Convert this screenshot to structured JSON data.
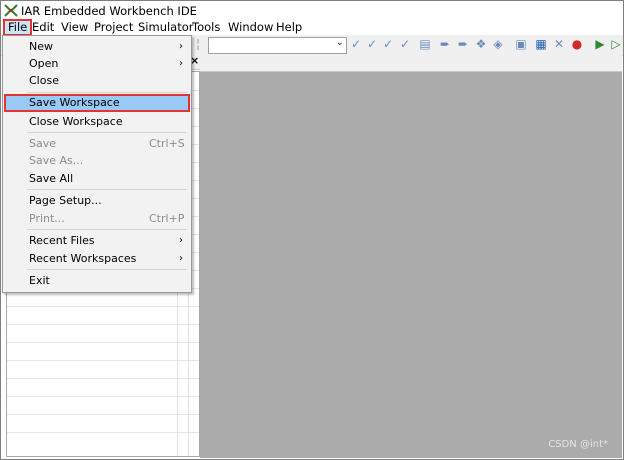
{
  "window": {
    "title": "IAR Embedded Workbench IDE"
  },
  "menubar": {
    "items": [
      "File",
      "Edit",
      "View",
      "Project",
      "Simulator",
      "Tools",
      "Window",
      "Help"
    ]
  },
  "file_menu": {
    "new": "New",
    "open": "Open",
    "close": "Close",
    "save_workspace": "Save Workspace",
    "close_workspace": "Close Workspace",
    "save": "Save",
    "save_shortcut": "Ctrl+S",
    "save_as": "Save As...",
    "save_all": "Save All",
    "page_setup": "Page Setup...",
    "print": "Print...",
    "print_shortcut": "Ctrl+P",
    "recent_files": "Recent Files",
    "recent_workspaces": "Recent Workspaces",
    "exit": "Exit"
  },
  "panel": {
    "close_glyph": "×"
  },
  "watermark": "CSDN @int*"
}
